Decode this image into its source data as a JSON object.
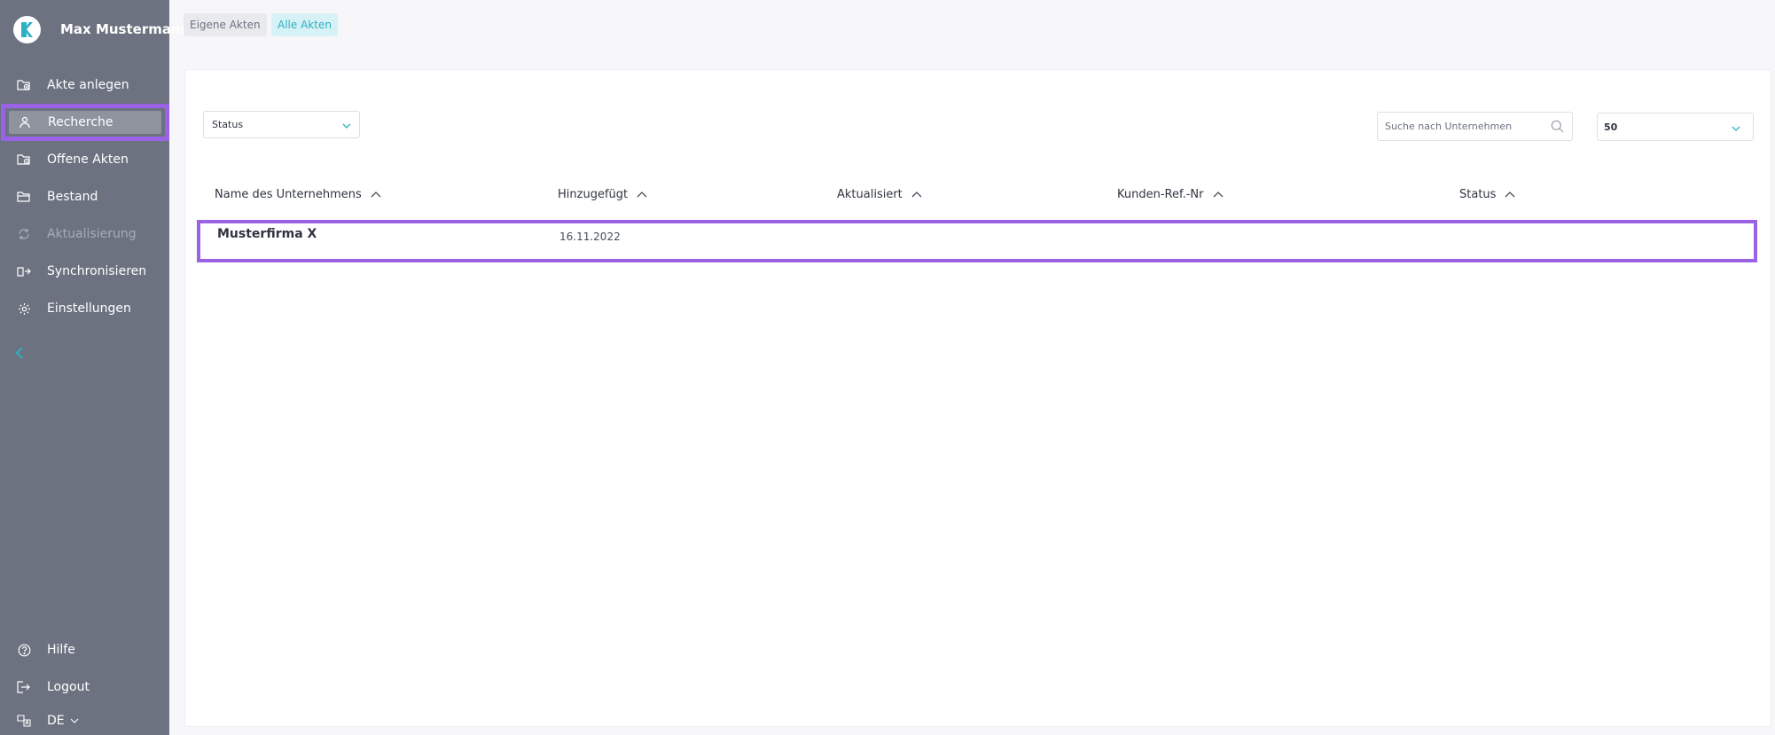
{
  "sidebar": {
    "user_name": "Max Mustermann",
    "items": [
      {
        "label": "Akte anlegen",
        "icon": "folder-add-icon"
      },
      {
        "label": "Recherche",
        "icon": "research-icon"
      },
      {
        "label": "Offene Akten",
        "icon": "folder-open-icon"
      },
      {
        "label": "Bestand",
        "icon": "folder-icon"
      },
      {
        "label": "Aktualisierung",
        "icon": "refresh-icon"
      },
      {
        "label": "Synchronisieren",
        "icon": "sync-icon"
      },
      {
        "label": "Einstellungen",
        "icon": "gear-icon"
      }
    ],
    "help_label": "Hilfe",
    "logout_label": "Logout",
    "language": "DE",
    "accent_color": "#2bb0c4",
    "highlight_color": "#9a63e6"
  },
  "tabs": {
    "own": "Eigene Akten",
    "all": "Alle Akten"
  },
  "filters": {
    "status_label": "Status",
    "search_placeholder": "Suche nach Unternehmen",
    "per_page": "50"
  },
  "table": {
    "headers": [
      "Name des Unternehmens",
      "Hinzugefügt",
      "Aktualisiert",
      "Kunden-Ref.-Nr",
      "Status"
    ],
    "rows": [
      {
        "name": "Musterfirma X",
        "added": "16.11.2022",
        "updated": "",
        "ref": "",
        "status": ""
      }
    ]
  }
}
